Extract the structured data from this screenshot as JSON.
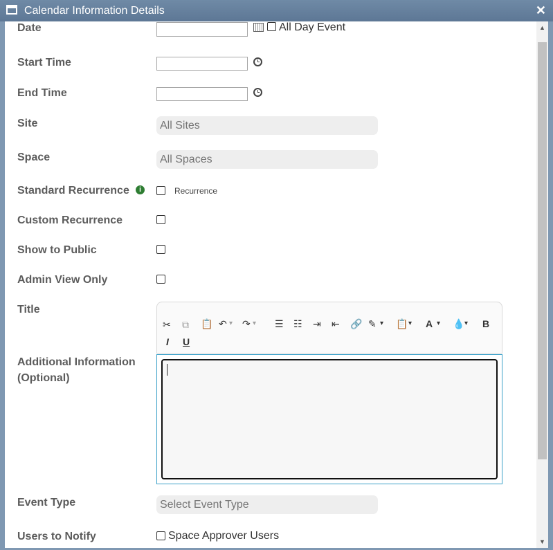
{
  "window": {
    "title": "Calendar Information Details",
    "close_glyph": "✕"
  },
  "fields": {
    "date_label": "Date",
    "all_day_label": "All Day Event",
    "start_time_label": "Start Time",
    "end_time_label": "End Time",
    "site_label": "Site",
    "site_value": "All Sites",
    "space_label": "Space",
    "space_value": "All Spaces",
    "standard_recurrence_label": "Standard Recurrence",
    "recurrence_label": "Recurrence",
    "custom_recurrence_label": "Custom Recurrence",
    "show_public_label": "Show to Public",
    "admin_view_label": "Admin View Only",
    "title_label": "Title",
    "additional_info_label_1": "Additional Information",
    "additional_info_label_2": "(Optional)",
    "event_type_label": "Event Type",
    "event_type_value": "Select Event Type",
    "users_notify_label": "Users to Notify",
    "space_approver_label": "Space Approver Users"
  },
  "toolbar": {
    "bold": "B",
    "italic": "I",
    "underline": "U",
    "font_color": "A"
  },
  "icons": {
    "info": "i",
    "arrow_down": "▾",
    "scroll_up": "▲",
    "scroll_down": "▼"
  },
  "colors": {
    "titlebar": "#6f8aa6",
    "label": "#5c5c5c",
    "info_green": "#2e7d32",
    "editor_border": "#3aa0c8"
  }
}
